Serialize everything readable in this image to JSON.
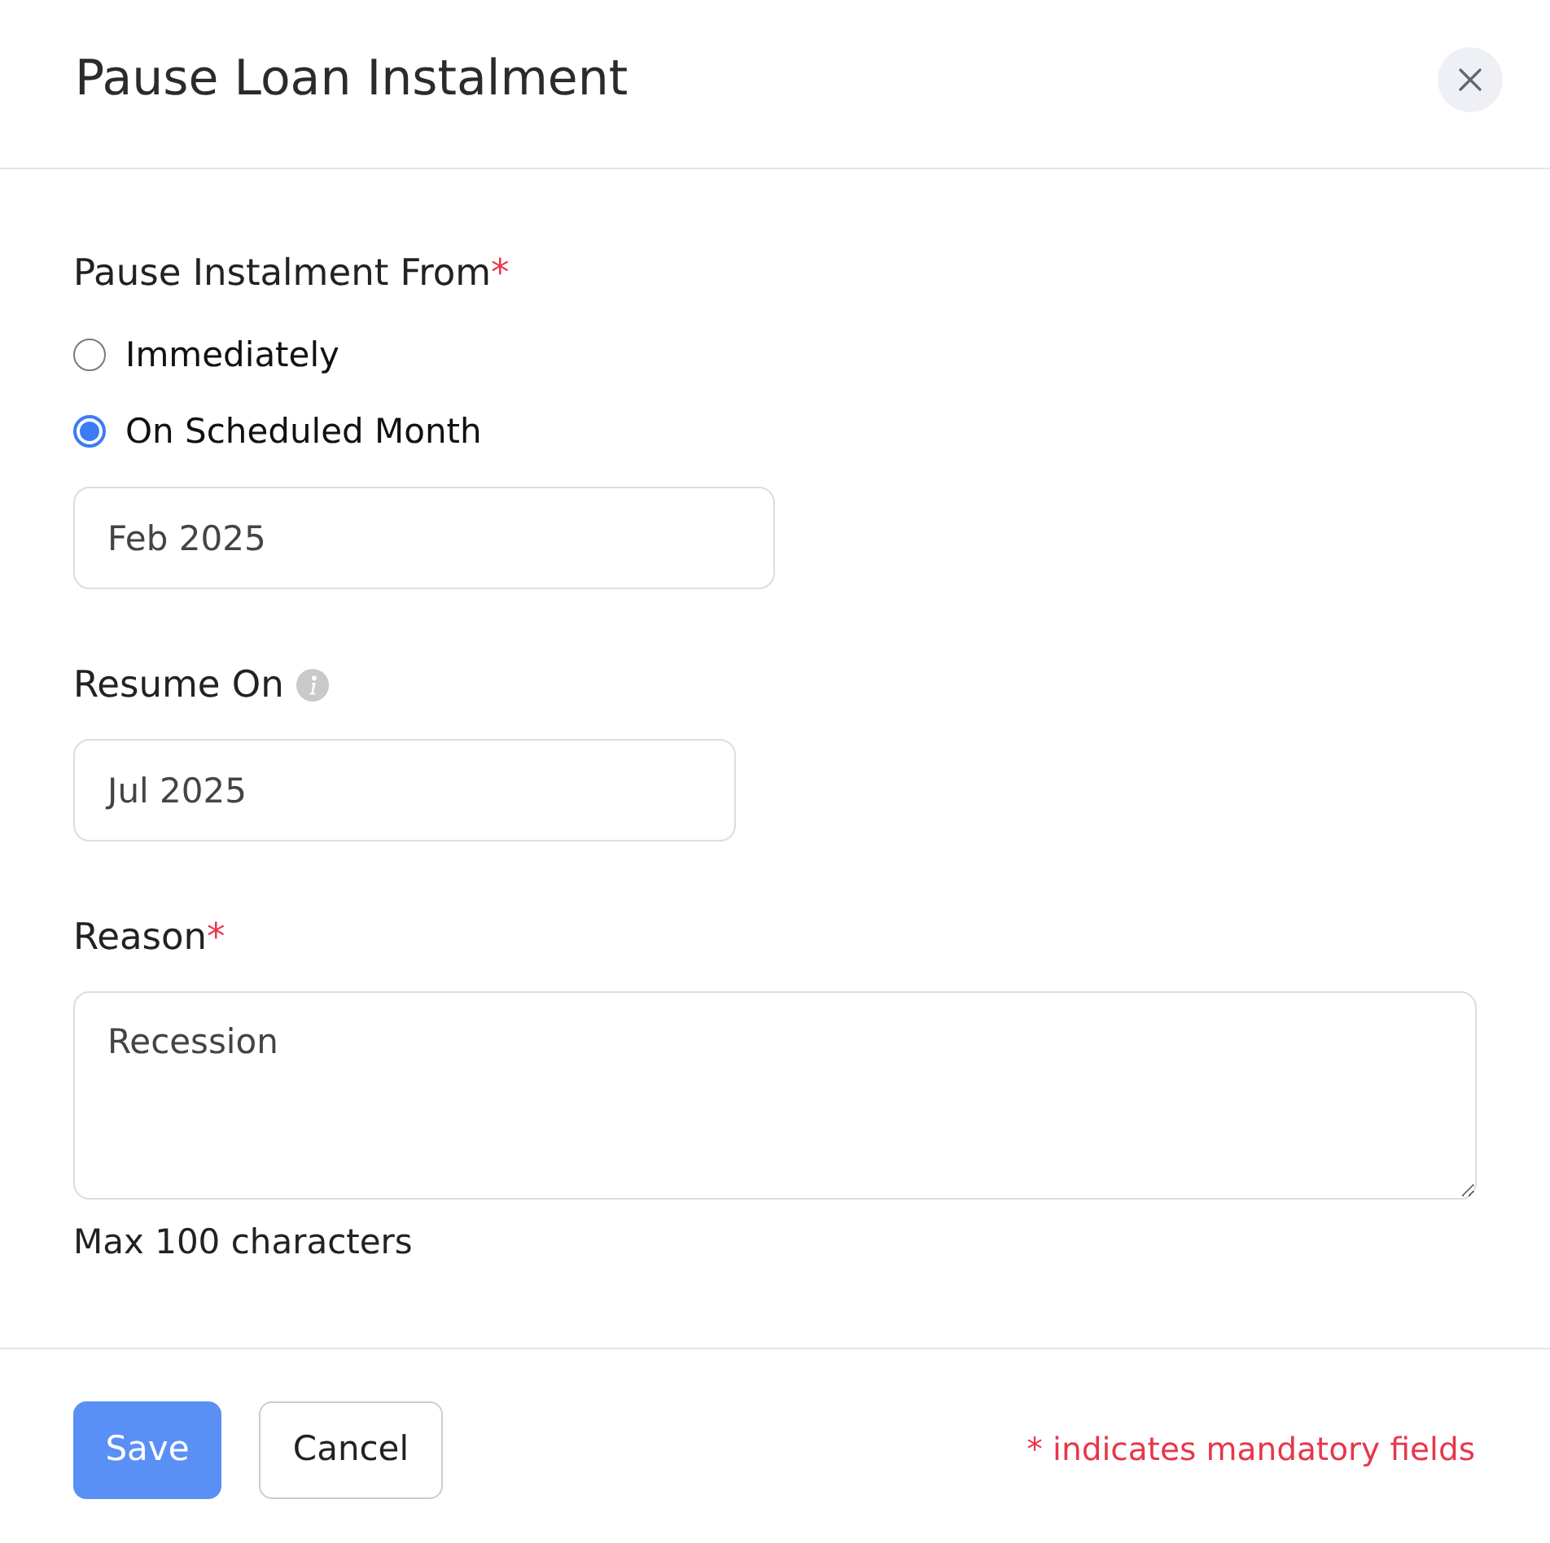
{
  "dialog": {
    "title": "Pause Loan Instalment"
  },
  "form": [
    {
      "kind": "radio_group",
      "label": "Pause Instalment From",
      "required_mark": "*",
      "options": [
        {
          "label": "Immediately",
          "selected": false
        },
        {
          "label": "On Scheduled Month",
          "selected": true
        }
      ],
      "value": "Feb 2025"
    },
    {
      "kind": "input",
      "label": "Resume On",
      "info": true,
      "value": "Jul 2025"
    },
    {
      "kind": "textarea",
      "label": "Reason",
      "required_mark": "*",
      "value": "Recession",
      "hint": "Max 100 characters"
    }
  ],
  "footer": {
    "buttons": [
      {
        "label": "Save",
        "kind": "primary"
      },
      {
        "label": "Cancel",
        "kind": "secondary"
      }
    ],
    "note": "* indicates mandatory fields"
  }
}
